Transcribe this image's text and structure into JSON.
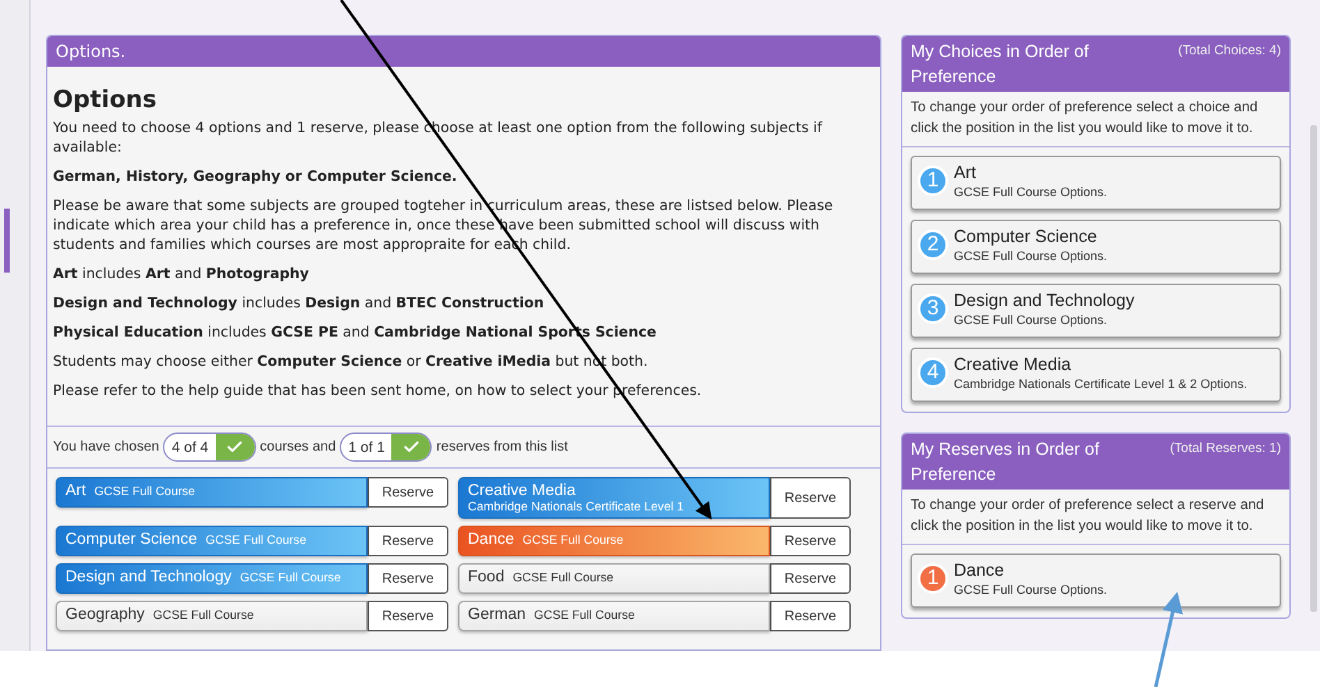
{
  "options_panel": {
    "header": "Options.",
    "title": "Options",
    "paragraphs": [
      {
        "text": "You need to choose 4 options and 1 reserve, please choose at least one option from the following subjects if available:",
        "strong": false
      },
      {
        "text": "German, History, Geography or Computer Science.",
        "strong": true
      },
      {
        "text": "Please be aware that some subjects are grouped togteher in curriculum areas, these are listsed below. Please indicate which area your child has a preference in, once these have been submitted school will discuss with students and families which courses are most appropraite for each child.",
        "strong": false
      },
      {
        "text": "**Art** includes **Art** and **Photography**",
        "strong": false
      },
      {
        "text": "**Design and Technology** includes **Design** and **BTEC Construction**",
        "strong": false
      },
      {
        "text": "**Physical Education** includes **GCSE PE** and **Cambridge National Sports Science**",
        "strong": false
      },
      {
        "text": "Students may choose either **Computer Science** or **Creative iMedia** but not both.",
        "strong": false
      },
      {
        "text": "Please refer to the help guide that has been sent home, on how to select your preferences.",
        "strong": false
      }
    ]
  },
  "summary": {
    "prefix": "You have chosen",
    "courses_count": "4 of 4",
    "courses_complete": true,
    "middle": "courses and",
    "reserves_count": "1 of 1",
    "reserves_complete": true,
    "suffix": "reserves from this list"
  },
  "courses": [
    {
      "name": "Art",
      "detail": "GCSE Full Course",
      "kind": "choice",
      "button": "Reserve"
    },
    {
      "name": "Creative Media",
      "detail": "Cambridge Nationals Certificate Level 1",
      "kind": "choice",
      "button": "Reserve"
    },
    {
      "name": "Computer Science",
      "detail": "GCSE Full Course",
      "kind": "choice",
      "button": "Reserve"
    },
    {
      "name": "Dance",
      "detail": "GCSE Full Course",
      "kind": "reserve",
      "button": "Reserve"
    },
    {
      "name": "Design and Technology",
      "detail": "GCSE Full Course",
      "kind": "choice",
      "button": "Reserve"
    },
    {
      "name": "Food",
      "detail": "GCSE Full Course",
      "kind": "none",
      "button": "Reserve"
    },
    {
      "name": "Geography",
      "detail": "GCSE Full Course",
      "kind": "none",
      "button": "Reserve"
    },
    {
      "name": "German",
      "detail": "GCSE Full Course",
      "kind": "none",
      "button": "Reserve"
    }
  ],
  "side_panels": [
    {
      "kind": "choice",
      "title": "My Choices in Order of Preference",
      "total": "(Total Choices: 4)",
      "hint": "To change your order of preference select a choice and click the position in the list you would like to move it to.",
      "items": [
        {
          "number": "1",
          "name": "Art",
          "detail": "GCSE Full Course Options."
        },
        {
          "number": "2",
          "name": "Computer Science",
          "detail": "GCSE Full Course Options."
        },
        {
          "number": "3",
          "name": "Design and Technology",
          "detail": "GCSE Full Course Options."
        },
        {
          "number": "4",
          "name": "Creative Media",
          "detail": "Cambridge Nationals Certificate Level 1 & 2 Options."
        }
      ]
    },
    {
      "kind": "reserve",
      "title": "My Reserves in Order of Preference",
      "total": "(Total Reserves: 1)",
      "hint": "To change your order of preference select a reserve and click the position in the list you would like to move it to.",
      "items": [
        {
          "number": "1",
          "name": "Dance",
          "detail": "GCSE Full Course Options."
        }
      ]
    }
  ]
}
